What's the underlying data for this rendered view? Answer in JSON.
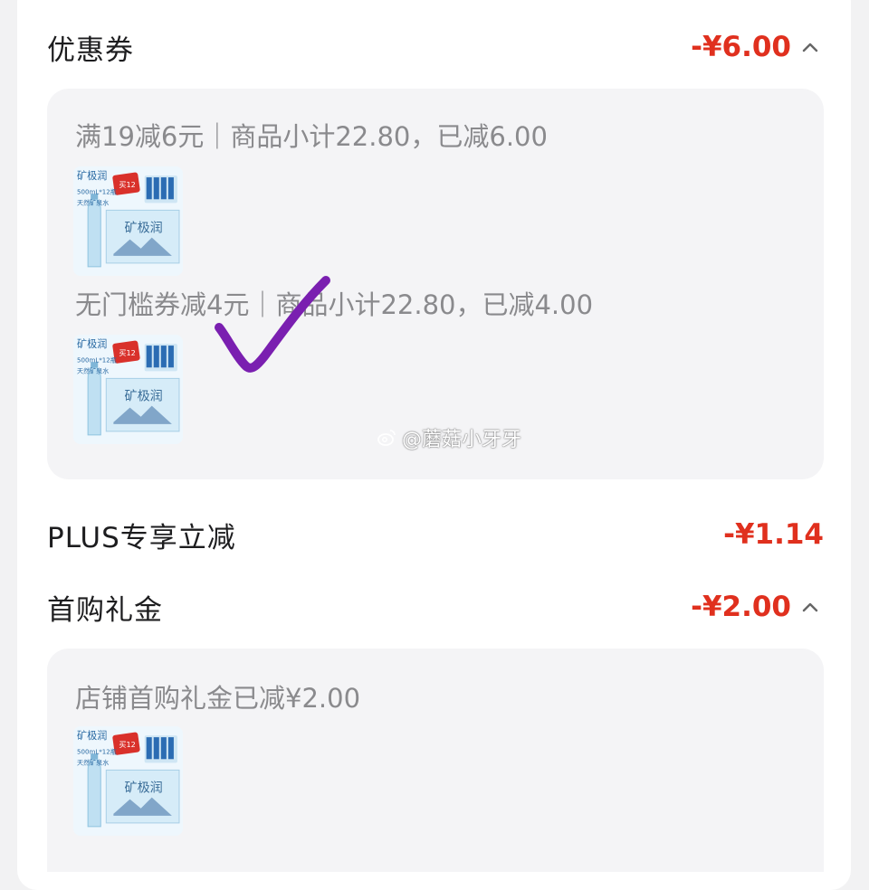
{
  "sections": {
    "coupon": {
      "title": "优惠券",
      "amount": "-¥6.00",
      "icon": "chevron-up-icon",
      "items": [
        {
          "text": "满19减6元｜商品小计22.80，已减6.00",
          "image": "product-thumbnail"
        },
        {
          "text": "无门槛券减4元｜商品小计22.80，已减4.00",
          "image": "product-thumbnail"
        }
      ]
    },
    "plus": {
      "title": "PLUS专享立减",
      "amount": "-¥1.14"
    },
    "first_purchase": {
      "title": "首购礼金",
      "amount": "-¥2.00",
      "icon": "chevron-up-icon",
      "items": [
        {
          "text": "店铺首购礼金已减¥2.00",
          "image": "product-thumbnail"
        }
      ]
    }
  },
  "product": {
    "brand": "矿极润",
    "spec": "500mL*12瓶",
    "tag": "天然矿泉水",
    "badge": "买12"
  },
  "watermark": "@蘑菇小牙牙",
  "annotation": "hand-drawn-checkmark",
  "colors": {
    "accent": "#e0301e",
    "check": "#7a1fb0",
    "background": "#f2f2f3",
    "panel": "#f4f4f6"
  }
}
